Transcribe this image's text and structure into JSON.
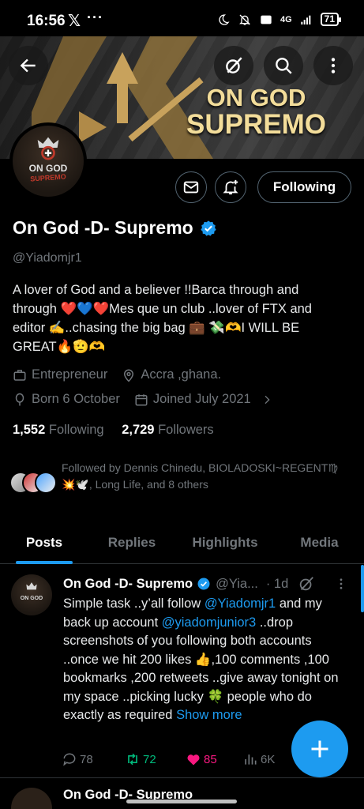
{
  "status_bar": {
    "time": "16:56",
    "x_logo": "𝕏",
    "more": "···",
    "network": "4G",
    "battery": "71"
  },
  "banner": {
    "line1": "ON GOD",
    "line2": "SUPREMO"
  },
  "avatar": {
    "line1": "ON GOD",
    "line2": "SUPREMO"
  },
  "profile": {
    "follow_state_label": "Following",
    "name": "On God -D- Supremo",
    "handle": "@Yiadomjr1",
    "bio": "A lover of God and a believer !!Barca through and through ❤️💙❤️Mes que un club ..lover of FTX and editor ✍️..chasing the big bag 💼 💸🫶I WILL BE GREAT🔥🫡🫶",
    "profession": "Entrepreneur",
    "location": "Accra ,ghana.",
    "born": "Born 6 October",
    "joined": "Joined July 2021",
    "following_count": "1,552",
    "following_label": "Following",
    "followers_count": "2,729",
    "followers_label": "Followers",
    "followed_by": "Followed by Dennis Chinedu, BIOLADOSKI~REGENT♍💥🕊️, Long Life, and 8 others"
  },
  "tabs": [
    {
      "label": "Posts",
      "active": true
    },
    {
      "label": "Replies",
      "active": false
    },
    {
      "label": "Highlights",
      "active": false
    },
    {
      "label": "Media",
      "active": false
    }
  ],
  "post": {
    "avatar_text": "ON GOD",
    "name": "On God -D- Supremo",
    "handle": "@Yia...",
    "time": "· 1d",
    "text_a": "Simple task ..y’all follow ",
    "mention1": "@Yiadomjr1",
    "text_b": " and my back up account ",
    "mention2": "@yiadomjunior3",
    "text_c": " ..drop screenshots of you following both accounts ..once we hit  200 likes 👍,100 comments ,100 bookmarks ,200 retweets ..give away tonight on my space ..picking lucky 🍀 people who do exactly as required ",
    "show_more": "Show more",
    "replies": "78",
    "reposts": "72",
    "likes": "85",
    "views": "6K"
  },
  "next_post": {
    "name": "On God -D- Supremo"
  },
  "colors": {
    "accent": "#1d9bf0",
    "repost": "#00ba7c",
    "like": "#f91880",
    "muted": "#71767b"
  },
  "icons": [
    "back-arrow-icon",
    "grok-icon",
    "search-icon",
    "more-vertical-icon",
    "mail-icon",
    "bell-plus-icon",
    "verified-icon",
    "briefcase-icon",
    "location-icon",
    "balloon-icon",
    "calendar-icon",
    "chevron-right-icon",
    "reply-icon",
    "repost-icon",
    "heart-icon",
    "views-icon",
    "plus-icon"
  ]
}
